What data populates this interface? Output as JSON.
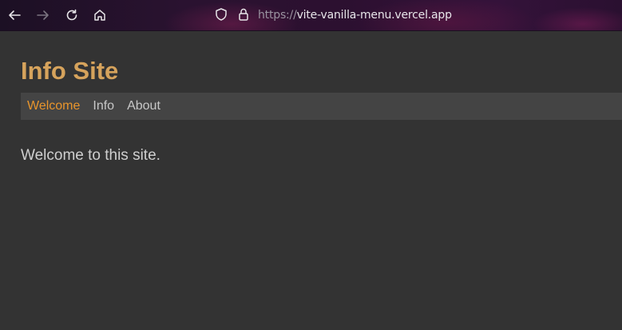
{
  "browser": {
    "url_protocol": "https://",
    "url_host": "vite-vanilla-menu.vercel.app",
    "icons": [
      "back-arrow-icon",
      "forward-arrow-icon",
      "reload-icon",
      "home-icon",
      "shield-icon",
      "lock-icon"
    ]
  },
  "site": {
    "title": "Info Site",
    "menu": [
      {
        "label": "Welcome",
        "active": true
      },
      {
        "label": "Info",
        "active": false
      },
      {
        "label": "About",
        "active": false
      }
    ],
    "content": "Welcome to this site."
  },
  "colors": {
    "background": "#333333",
    "menu_bar": "#444444",
    "title": "#d6a35c",
    "active_menu": "#e8952c",
    "menu_text": "#c8c8c8",
    "body_text": "#cfcfcf"
  }
}
